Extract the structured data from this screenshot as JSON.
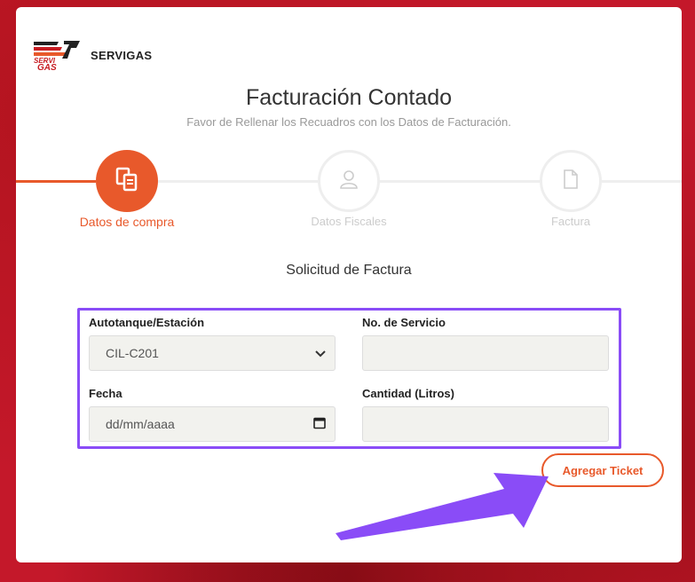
{
  "brand": {
    "name": "SERVIGAS",
    "logo_text_top": "SERVI",
    "logo_text_bottom": "GAS"
  },
  "header": {
    "title": "Facturación Contado",
    "subtitle": "Favor de Rellenar los Recuadros con los Datos de Facturación."
  },
  "steps": [
    {
      "label": "Datos de compra",
      "state": "active",
      "icon": "copy-icon"
    },
    {
      "label": "Datos Fiscales",
      "state": "inactive",
      "icon": "user-icon"
    },
    {
      "label": "Factura",
      "state": "inactive",
      "icon": "file-icon"
    }
  ],
  "section_title": "Solicitud de Factura",
  "form": {
    "station_label": "Autotanque/Estación",
    "station_value": "CIL-C201",
    "service_label": "No. de Servicio",
    "service_value": "",
    "date_label": "Fecha",
    "date_placeholder": "dd/mm/aaaa",
    "quantity_label": "Cantidad (Litros)",
    "quantity_value": ""
  },
  "add_ticket_label": "Agregar Ticket",
  "colors": {
    "accent": "#e8592b",
    "highlight": "#8a4cf7",
    "background": "#c4182a"
  }
}
